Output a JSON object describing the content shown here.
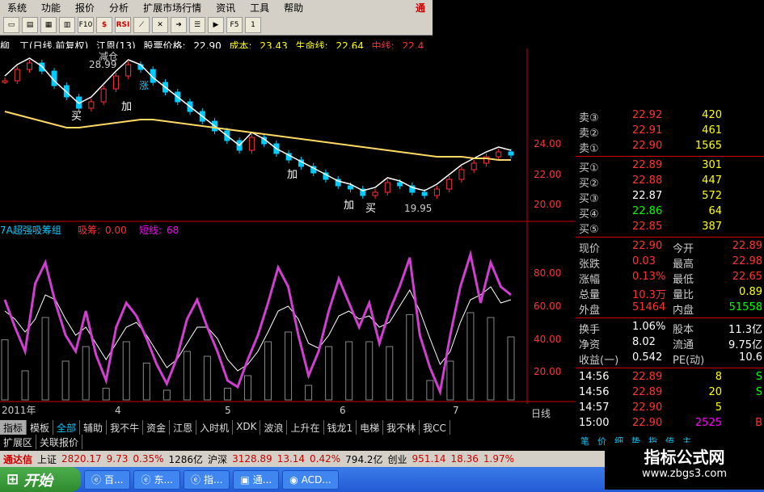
{
  "menu": [
    "系统",
    "功能",
    "报价",
    "分析",
    "扩展市场行情",
    "资讯",
    "工具",
    "帮助"
  ],
  "menu_hot": "通",
  "toolbar_icons": [
    "new-icon",
    "open-icon",
    "grid-icon",
    "chart-icon",
    "f10-icon",
    "dollar-icon",
    "rsi-icon",
    "line-icon",
    "x-icon",
    "arrow-icon",
    "list-icon",
    "play-icon",
    "f5-icon"
  ],
  "toolbar_text": {
    "f10": "F10",
    "rsi": "RSI",
    "f5": "F5",
    "one": "1"
  },
  "info": {
    "name": "柳　工(日线,前复权)",
    "indicator": "江恩(13)",
    "price_label": "股票价格:",
    "price": "22.90",
    "cost_label": "成本:",
    "cost": "23.43",
    "life_label": "生命线:",
    "life": "22.64",
    "mid_label": "中线:",
    "mid": "22.4"
  },
  "chart_texts": {
    "high_mark": "28.99",
    "low_mark": "19.95",
    "reduce": "减仓",
    "buy": "买",
    "add": "加",
    "rise": "涨",
    "lower_title": "7A超强吸筹组",
    "absorb_label": "吸筹:",
    "absorb_value": "0.00",
    "short_label": "短线:",
    "short_value": "68",
    "year": "2011年",
    "month4": "4",
    "month5": "5",
    "month6": "6",
    "month7": "7",
    "period": "日线"
  },
  "axis": {
    "upper": [
      "24.00",
      "22.00",
      "20.00"
    ],
    "lower": [
      "80.00",
      "60.00",
      "40.00",
      "20.00"
    ]
  },
  "chart_data": {
    "type": "line",
    "upper_series": {
      "close": [
        27.5,
        28.2,
        28.6,
        28.1,
        27.2,
        26.5,
        25.8,
        26.2,
        27.0,
        27.8,
        28.5,
        28.2,
        27.4,
        26.8,
        26.2,
        25.6,
        25.0,
        24.4,
        23.8,
        23.2,
        24.0,
        23.6,
        23.0,
        22.6,
        22.2,
        21.8,
        21.4,
        21.0,
        20.8,
        20.4,
        20.6,
        21.2,
        21.0,
        20.6,
        20.4,
        20.8,
        21.4,
        22.0,
        22.4,
        22.8,
        23.1,
        22.9
      ],
      "yellow_ma": [
        25.6,
        25.4,
        25.2,
        25.0,
        24.8,
        24.6,
        24.6,
        24.7,
        24.8,
        24.9,
        25.0,
        25.1,
        25.1,
        25.0,
        24.9,
        24.8,
        24.7,
        24.6,
        24.5,
        24.4,
        24.3,
        24.2,
        24.1,
        24.0,
        23.9,
        23.8,
        23.7,
        23.6,
        23.5,
        23.4,
        23.3,
        23.2,
        23.1,
        23.0,
        22.9,
        22.8,
        22.8,
        22.8,
        22.7,
        22.7,
        22.6,
        22.6
      ]
    },
    "lower_series": {
      "magenta": [
        62,
        45,
        30,
        72,
        85,
        60,
        40,
        30,
        55,
        28,
        12,
        45,
        60,
        52,
        38,
        22,
        10,
        26,
        50,
        62,
        45,
        30,
        12,
        8,
        25,
        40,
        60,
        82,
        70,
        40,
        15,
        30,
        55,
        75,
        60,
        45,
        60,
        35,
        55,
        70,
        88,
        40,
        20,
        5,
        40,
        70,
        90,
        60,
        85,
        70,
        65
      ],
      "white": [
        55,
        50,
        42,
        50,
        65,
        62,
        50,
        40,
        45,
        35,
        25,
        35,
        45,
        48,
        40,
        30,
        20,
        25,
        35,
        45,
        45,
        38,
        25,
        18,
        22,
        30,
        42,
        55,
        58,
        50,
        35,
        32,
        40,
        52,
        55,
        50,
        52,
        45,
        48,
        58,
        68,
        55,
        38,
        22,
        30,
        48,
        62,
        65,
        70,
        60,
        62
      ]
    },
    "ylim_upper": [
      19.5,
      29.0
    ],
    "ylim_lower": [
      0,
      85
    ]
  },
  "quotes": {
    "sell": [
      {
        "label": "卖③",
        "price": "22.92",
        "vol": "420"
      },
      {
        "label": "卖②",
        "price": "22.91",
        "vol": "461"
      },
      {
        "label": "卖①",
        "price": "22.90",
        "vol": "1565"
      }
    ],
    "buy": [
      {
        "label": "买①",
        "price": "22.89",
        "vol": "301"
      },
      {
        "label": "买②",
        "price": "22.88",
        "vol": "447"
      },
      {
        "label": "买③",
        "price": "22.87",
        "vol": "572"
      },
      {
        "label": "买④",
        "price": "22.86",
        "vol": "64"
      },
      {
        "label": "买⑤",
        "price": "22.85",
        "vol": "387"
      }
    ],
    "stats": [
      {
        "l1": "现价",
        "v1": "22.90",
        "l2": "今开",
        "v2": "22.89"
      },
      {
        "l1": "张跌",
        "v1": "0.03",
        "l2": "最高",
        "v2": "22.98"
      },
      {
        "l1": "涨幅",
        "v1": "0.13%",
        "l2": "最低",
        "v2": "22.65"
      },
      {
        "l1": "总量",
        "v1": "10.3万",
        "l2": "量比",
        "v2": "0.89"
      },
      {
        "l1": "外盘",
        "v1": "51464",
        "l2": "内盘",
        "v2": "51558"
      }
    ],
    "stats2": [
      {
        "l1": "换手",
        "v1": "1.06%",
        "l2": "股本",
        "v2": "11.3亿"
      },
      {
        "l1": "净资",
        "v1": "8.02",
        "l2": "流通",
        "v2": "9.75亿"
      },
      {
        "l1": "收益(一)",
        "v1": "0.542",
        "l2": "PE(动)",
        "v2": "10.6"
      }
    ],
    "ticks": [
      {
        "time": "14:56",
        "price": "22.89",
        "vol": "8",
        "bs": "S"
      },
      {
        "time": "14:56",
        "price": "22.89",
        "vol": "20",
        "bs": "S"
      },
      {
        "time": "14:57",
        "price": "22.90",
        "vol": "5",
        "bs": ""
      },
      {
        "time": "15:00",
        "price": "22.90",
        "vol": "2525",
        "bs": "B"
      }
    ]
  },
  "tabs": [
    "指标",
    "模板",
    "全部",
    "辅助",
    "我不牛",
    "资金",
    "江恩",
    "入时机",
    "XDK",
    "波浪",
    "上升在",
    "钱龙1",
    "电梯",
    "我不林",
    "我CC"
  ],
  "tabs2": [
    "扩展区",
    "关联报价"
  ],
  "nav": [
    "+",
    "-",
    "+"
  ],
  "right_tabs": [
    "笔",
    "价",
    "细",
    "势",
    "指",
    "值",
    "主"
  ],
  "status": [
    {
      "t": "通达信",
      "c": "#c00"
    },
    {
      "t": "上证",
      "c": "#000"
    },
    {
      "t": "2820.17",
      "c": "#c00"
    },
    {
      "t": "9.73",
      "c": "#c00"
    },
    {
      "t": "0.35%",
      "c": "#c00"
    },
    {
      "t": "1286亿",
      "c": "#000"
    },
    {
      "t": "沪深",
      "c": "#000"
    },
    {
      "t": "3128.89",
      "c": "#c00"
    },
    {
      "t": "13.14",
      "c": "#c00"
    },
    {
      "t": "0.42%",
      "c": "#c00"
    },
    {
      "t": "794.2亿",
      "c": "#000"
    },
    {
      "t": "创业",
      "c": "#000"
    },
    {
      "t": "951.14",
      "c": "#c00"
    },
    {
      "t": "18.36",
      "c": "#c00"
    },
    {
      "t": "1.97%",
      "c": "#c00"
    }
  ],
  "taskbar": {
    "start": "开始",
    "items": [
      "百...",
      "东...",
      "指...",
      "通...",
      "ACD..."
    ]
  },
  "watermark": {
    "line1": "指标公式网",
    "line2": "www.zbgs3.com"
  }
}
